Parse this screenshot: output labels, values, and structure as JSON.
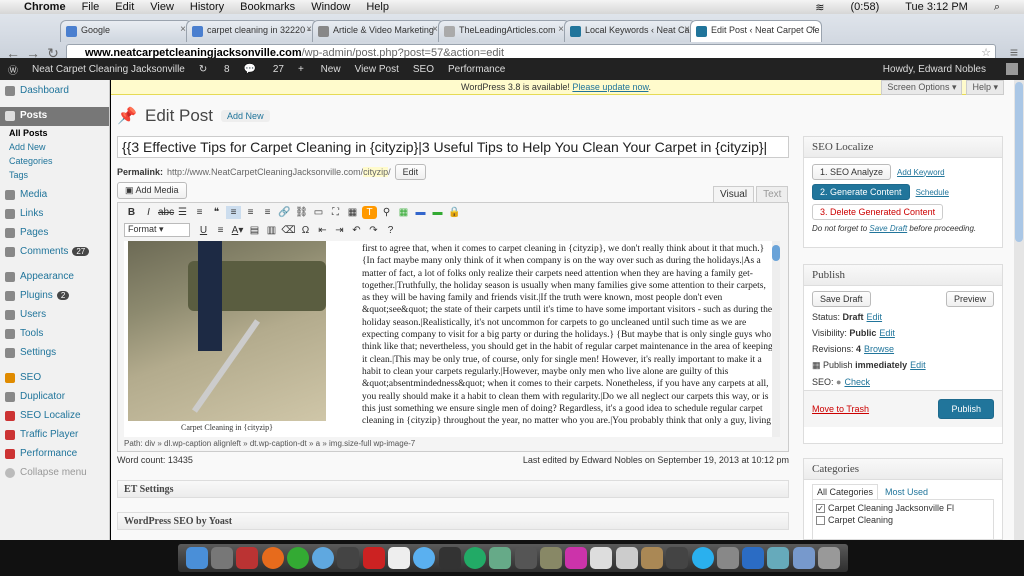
{
  "macmenu": {
    "apple": "",
    "app": "Chrome",
    "items": [
      "File",
      "Edit",
      "View",
      "History",
      "Bookmarks",
      "Window",
      "Help"
    ],
    "battery": "(0:58)",
    "clock": "Tue 3:12 PM"
  },
  "tabs": [
    {
      "label": "Google"
    },
    {
      "label": "carpet cleaning in 32220 -"
    },
    {
      "label": "Article & Video Marketing"
    },
    {
      "label": "TheLeadingArticles.com"
    },
    {
      "label": "Local Keywords ‹ Neat Carp"
    },
    {
      "label": "Edit Post ‹ Neat Carpet Cle"
    }
  ],
  "url": {
    "host": "www.neatcarpetcleaningjacksonville.com",
    "path": "/wp-admin/post.php?post=57&action=edit"
  },
  "adminbar": {
    "site": "Neat Carpet Cleaning Jacksonville",
    "updates": "8",
    "comments": "27",
    "new": "New",
    "view": "View Post",
    "seo": "SEO",
    "perf": "Performance",
    "howdy": "Howdy, Edward Nobles"
  },
  "sidebar": {
    "dashboard": "Dashboard",
    "posts": "Posts",
    "all": "All Posts",
    "addnew": "Add New",
    "categories": "Categories",
    "tags": "Tags",
    "media": "Media",
    "links": "Links",
    "pages": "Pages",
    "comments": "Comments",
    "comments_count": "27",
    "appearance": "Appearance",
    "plugins": "Plugins",
    "plugins_count": "2",
    "users": "Users",
    "tools": "Tools",
    "settings": "Settings",
    "seo": "SEO",
    "duplicator": "Duplicator",
    "seolocalize": "SEO Localize",
    "traffic": "Traffic Player",
    "performance": "Performance",
    "collapse": "Collapse menu"
  },
  "notice": {
    "text": "WordPress 3.8 is available!",
    "link": "Please update now",
    "end": "."
  },
  "screen_options": "Screen Options ▾",
  "help": "Help ▾",
  "heading": "Edit Post",
  "addnew_btn": "Add New",
  "post_title": "{{3 Effective Tips for Carpet Cleaning in {cityzip}|3 Useful Tips to Help You Clean Your Carpet in {cityzip}|",
  "permalink": {
    "label": "Permalink:",
    "base": "http://www.NeatCarpetCleaningJacksonville.com/",
    "slug": "cityzip",
    "tail": "/",
    "edit": "Edit"
  },
  "add_media": "Add Media",
  "vtabs": {
    "visual": "Visual",
    "text": "Text"
  },
  "format": "Format",
  "caption": "Carpet Cleaning in {cityzip}",
  "body_text": "first to agree that, when it comes to carpet cleaning in {cityzip}, we don't really think about it that much.} {In fact maybe many only think of it when company is on the way over such as during the holidays.|As a matter of fact, a lot of folks only realize their carpets need attention when they are having a family get-together.|Truthfully, the holiday season is usually when many families give some attention to their carpets, as they will be having family and friends visit.|If the truth were known, most people don't even &quot;see&quot; the state of their carpets until it's time to have some important visitors - such as during the holiday season.|Realistically, it's not uncommon for carpets to go uncleaned until such time as we are expecting company to visit for a big party or during the holidays.} {But maybe that is only single guys who think like that; nevertheless, you should get in the habit of regular carpet maintenance in the area of keeping it clean.|This may be only true, of course, only for single men! However, it's really important to make it a habit to clean your carpets regularly.|However, maybe only men who live alone are guilty of this &quot;absentmindedness&quot; when it comes to their carpets. Nonetheless, if you have any carpets at all, you really should make it a habit to clean them with regularity.|Do we all neglect our carpets this way, or is this just something we ensure single men of doing? Regardless, it's a good idea to schedule regular carpet cleaning in {cityzip} throughout the year, no matter who you are.|You probably think that only a guy, living",
  "path": "Path: div » dl.wp-caption alignleft » dt.wp-caption-dt » a » img.size-full wp-image-7",
  "wordcount": "Word count: 13435",
  "lastedited": "Last edited by Edward Nobles on September 19, 2013 at 10:12 pm",
  "et_settings": "ET Settings",
  "yoast": "WordPress SEO by Yoast",
  "seolocalize": {
    "title": "SEO Localize",
    "analyze": "1. SEO Analyze",
    "addkw": "Add Keyword",
    "generate": "2. Generate Content",
    "schedule": "Schedule",
    "delete": "3. Delete Generated Content",
    "note_a": "Do not forget to ",
    "note_link": "Save Draft",
    "note_b": " before proceeding."
  },
  "publish": {
    "title": "Publish",
    "save": "Save Draft",
    "preview": "Preview",
    "status_l": "Status:",
    "status": "Draft",
    "visibility_l": "Visibility:",
    "visibility": "Public",
    "revisions_l": "Revisions:",
    "revisions": "4",
    "browse": "Browse",
    "pub_l": "Publish",
    "pub": "immediately",
    "seo_l": "SEO:",
    "check": "Check",
    "edit": "Edit",
    "trash": "Move to Trash",
    "button": "Publish"
  },
  "categories": {
    "title": "Categories",
    "all": "All Categories",
    "most": "Most Used",
    "items": [
      "Carpet Cleaning Jacksonville Fl",
      "Carpet Cleaning"
    ]
  },
  "colors": {
    "wpblue": "#21759b",
    "adminbar": "#222222",
    "notice": "#fffbcc"
  }
}
